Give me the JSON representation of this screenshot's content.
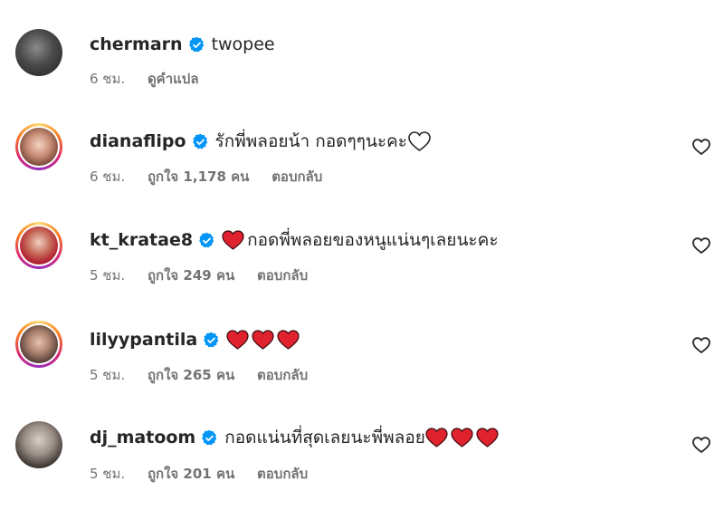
{
  "colors": {
    "text": "#262626",
    "meta": "#737373",
    "verified": "#0095f6",
    "heart": "#e0222f"
  },
  "comments": [
    {
      "username": "chermarn",
      "text": "twopee",
      "text_after": "",
      "time": "6 ชม.",
      "likes_label": "",
      "reply_label": "",
      "translate_label": "ดูคำแปล",
      "heart_emoji_count": 0,
      "outline_heart": false,
      "like_button": false
    },
    {
      "username": "dianaflipo",
      "text": "รักพี่พลอยน้า กอดๆๆนะคะ",
      "text_after": "",
      "time": "6 ชม.",
      "likes_label": "ถูกใจ 1,178 คน",
      "reply_label": "ตอบกลับ",
      "translate_label": "",
      "heart_emoji_count": 0,
      "outline_heart": true,
      "like_button": true
    },
    {
      "username": "kt_kratae8",
      "text": "กอดพี่พลอยของหนูแน่นๆเลยนะคะ",
      "text_after": "",
      "time": "5 ชม.",
      "likes_label": "ถูกใจ 249 คน",
      "reply_label": "ตอบกลับ",
      "translate_label": "",
      "heart_emoji_count": 1,
      "heart_position": "before",
      "outline_heart": false,
      "like_button": true
    },
    {
      "username": "lilyypantila",
      "text": "",
      "text_after": "",
      "time": "5 ชม.",
      "likes_label": "ถูกใจ 265 คน",
      "reply_label": "ตอบกลับ",
      "translate_label": "",
      "heart_emoji_count": 3,
      "heart_position": "after",
      "outline_heart": false,
      "like_button": true
    },
    {
      "username": "dj_matoom",
      "text": "กอดแน่นที่สุดเลยนะพี่พลอย",
      "text_after": "",
      "time": "5 ชม.",
      "likes_label": "ถูกใจ 201 คน",
      "reply_label": "ตอบกลับ",
      "translate_label": "",
      "heart_emoji_count": 3,
      "heart_position": "after",
      "outline_heart": false,
      "like_button": true
    }
  ]
}
